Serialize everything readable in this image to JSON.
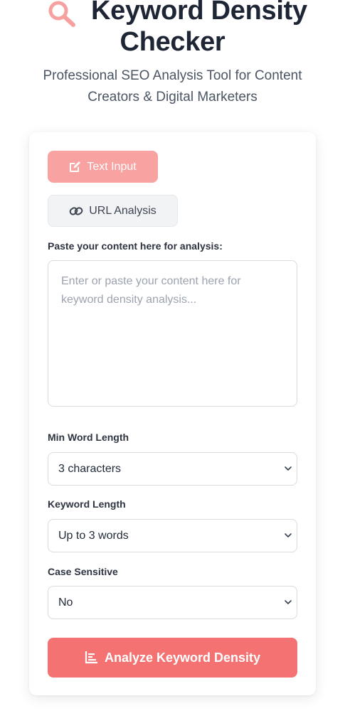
{
  "header": {
    "title_line1": "Keyword Density",
    "title_line2": "Checker",
    "subtitle": "Professional SEO Analysis Tool for Content Creators & Digital Marketers"
  },
  "tabs": [
    {
      "label": "Text Input",
      "icon": "edit-icon",
      "active": true
    },
    {
      "label": "URL Analysis",
      "icon": "link-icon",
      "active": false
    }
  ],
  "content": {
    "label": "Paste your content here for analysis:",
    "placeholder": "Enter or paste your content here for keyword density analysis..."
  },
  "options": {
    "min_word_length": {
      "label": "Min Word Length",
      "value": "3 characters"
    },
    "keyword_length": {
      "label": "Keyword Length",
      "value": "Up to 3 words"
    },
    "case_sensitive": {
      "label": "Case Sensitive",
      "value": "No"
    }
  },
  "analyze_button": {
    "label": "Analyze Keyword Density",
    "icon": "chart-icon"
  },
  "colors": {
    "accent": "#f47272",
    "active_tab": "#f8a2a2",
    "title": "#1e2535"
  }
}
